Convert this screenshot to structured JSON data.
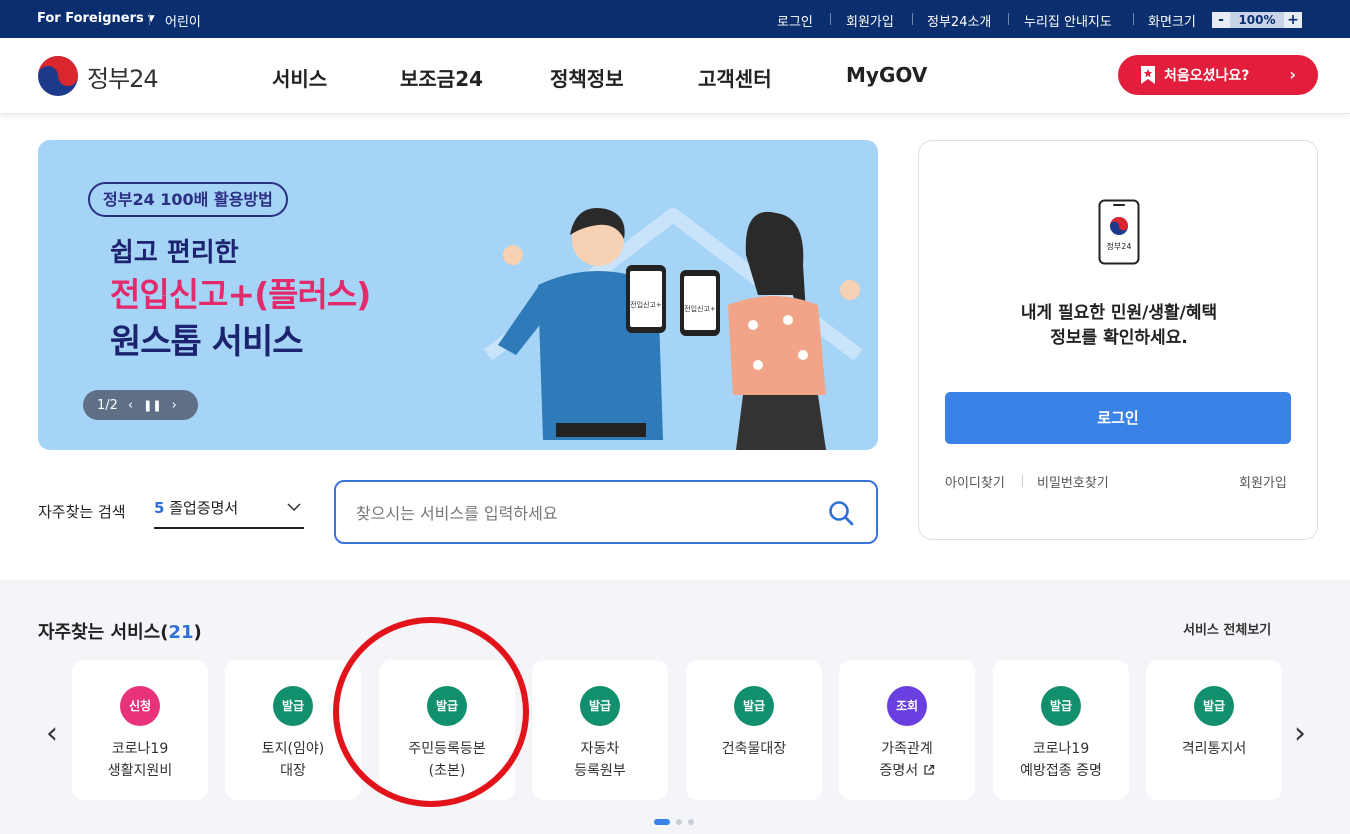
{
  "topbar": {
    "foreigners": "For Foreigners",
    "kids": "어린이",
    "login": "로그인",
    "signup": "회원가입",
    "intro": "정부24소개",
    "sitemap": "누리집 안내지도",
    "zoom_label": "화면크기",
    "zoom_minus": "-",
    "zoom_value": "100%",
    "zoom_plus": "+"
  },
  "header": {
    "logo_text": "정부24",
    "nav": [
      "서비스",
      "보조금24",
      "정책정보",
      "고객센터",
      "MyGOV"
    ],
    "first_visit": "처음오셨나요?"
  },
  "banner": {
    "pill": "정부24 100배 활용방법",
    "line1": "쉽고 편리한",
    "line2": "전입신고+(플러스)",
    "line3": "원스톱 서비스",
    "pager": "1/2",
    "phone_label": "전입신고+"
  },
  "search": {
    "freq_label": "자주찾는 검색",
    "freq_rank": "5",
    "freq_term": "졸업증명서",
    "placeholder": "찾으시는 서비스를 입력하세요"
  },
  "login_panel": {
    "device_label": "정부24",
    "message_line1": "내게 필요한 민원/생활/혜택",
    "message_line2": "정보를 확인하세요.",
    "login_button": "로그인",
    "find_id": "아이디찾기",
    "find_pw": "비밀번호찾기",
    "signup": "회원가입"
  },
  "services": {
    "title": "자주찾는 서비스",
    "count": "21",
    "view_all": "서비스 전체보기",
    "items": [
      {
        "badge": "신청",
        "color": "#e8337a",
        "line1": "코로나19",
        "line2": "생활지원비"
      },
      {
        "badge": "발급",
        "color": "#12906e",
        "line1": "토지(임야)",
        "line2": "대장"
      },
      {
        "badge": "발급",
        "color": "#12906e",
        "line1": "주민등록등본",
        "line2": "(초본)"
      },
      {
        "badge": "발급",
        "color": "#12906e",
        "line1": "자동차",
        "line2": "등록원부"
      },
      {
        "badge": "발급",
        "color": "#12906e",
        "line1": "건축물대장",
        "line2": ""
      },
      {
        "badge": "조회",
        "color": "#6a3fe0",
        "line1": "가족관계",
        "line2": "증명서"
      },
      {
        "badge": "발급",
        "color": "#12906e",
        "line1": "코로나19",
        "line2": "예방접종 증명"
      },
      {
        "badge": "발급",
        "color": "#12906e",
        "line1": "격리통지서",
        "line2": ""
      }
    ]
  },
  "colors": {
    "topbar": "#0a2e6e",
    "accent_red": "#e31e3c",
    "primary_blue": "#3b82e6",
    "banner_bg": "#a6d4f7",
    "annotation_red": "#e2131a"
  }
}
